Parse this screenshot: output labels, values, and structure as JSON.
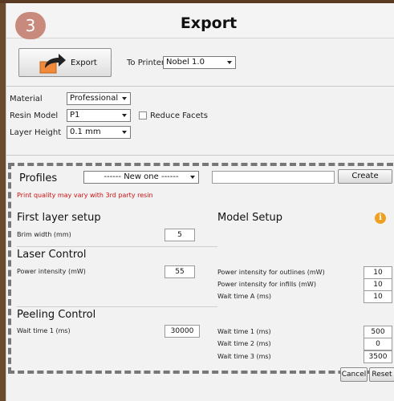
{
  "header": {
    "step": "3",
    "title": "Export"
  },
  "export_section": {
    "export_label": "Export",
    "to_printer_label": "To Printer",
    "printer_selected": "Nobel 1.0"
  },
  "material_section": {
    "material_label": "Material",
    "material_value": "Professional",
    "resin_label": "Resin Model",
    "resin_value": "P1",
    "reduce_facets_label": "Reduce Facets",
    "reduce_facets_checked": false,
    "layer_height_label": "Layer Height",
    "layer_height_value": "0.1 mm"
  },
  "profiles": {
    "title": "Profiles",
    "selected": "------ New one ------",
    "name_input": "",
    "create_label": "Create",
    "warning": "Print quality may vary with 3rd party resin"
  },
  "first_layer": {
    "title": "First layer setup",
    "brim_label": "Brim width (mm)",
    "brim_value": "5"
  },
  "model_setup": {
    "title": "Model Setup",
    "info_icon": "i"
  },
  "laser_control": {
    "title": "Laser Control",
    "power_label": "Power intensity (mW)",
    "power_value": "55",
    "outline_label": "Power intensity for outlines (mW)",
    "outline_value": "10",
    "infill_label": "Power intensity for infills (mW)",
    "infill_value": "10",
    "wait_a_label": "Wait time A (ms)",
    "wait_a_value": "10"
  },
  "peeling_control": {
    "title": "Peeling Control",
    "left_wait1_label": "Wait time 1 (ms)",
    "left_wait1_value": "30000",
    "wait1_label": "Wait time 1 (ms)",
    "wait1_value": "500",
    "wait2_label": "Wait time 2 (ms)",
    "wait2_value": "0",
    "wait3_label": "Wait time 3 (ms)",
    "wait3_value": "3500"
  },
  "footer": {
    "cancel_label": "Cancel",
    "reset_label": "Reset"
  },
  "colors": {
    "accent_badge": "#c98a7e",
    "warning": "#d01010",
    "info": "#f0a020",
    "frame": "#6b4a2e"
  }
}
